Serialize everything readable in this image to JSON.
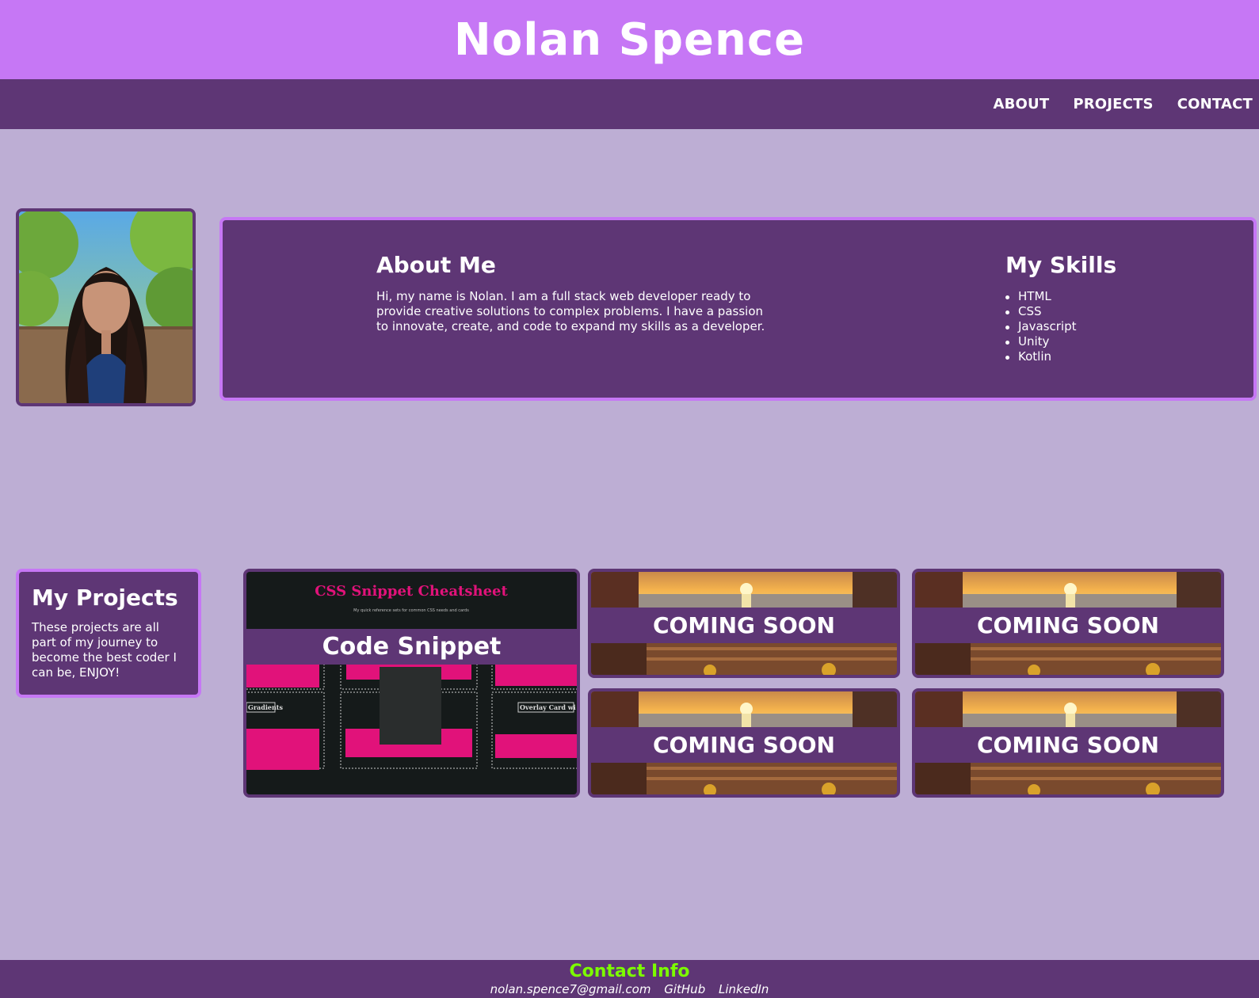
{
  "header": {
    "title": "Nolan Spence"
  },
  "nav": {
    "items": [
      "ABOUT",
      "PROJECTS",
      "CONTACT"
    ]
  },
  "about": {
    "heading": "About Me",
    "text": "Hi, my name is Nolan. I am a full stack web developer ready to provide creative solutions to complex problems. I have a passion to innovate, create, and code to expand my skills as a developer."
  },
  "skills": {
    "heading": "My Skills",
    "items": [
      "HTML",
      "CSS",
      "Javascript",
      "Unity",
      "Kotlin"
    ]
  },
  "projects": {
    "heading": "My Projects",
    "text": "These projects are all part of my journey to become the best coder I can be, ENJOY!",
    "main_card": {
      "label": "Code Snippet",
      "image_title": "CSS Snippet Cheatsheet",
      "image_subtitle": "My quick reference sets for common CSS needs and cards",
      "image_tags": [
        "Gradients",
        "Overlay Card wi"
      ]
    },
    "coming_soon": [
      "COMING SOON",
      "COMING SOON",
      "COMING SOON",
      "COMING SOON"
    ]
  },
  "footer": {
    "heading": "Contact Info",
    "email": "nolan.spence7@gmail.com",
    "github": "GitHub",
    "linkedin": "LinkedIn"
  },
  "colors": {
    "background": "#bdaed4",
    "header": "#c677f5",
    "nav": "#5e3675",
    "accent_green": "#7cfc00",
    "snippet_pink": "#e1127a"
  }
}
